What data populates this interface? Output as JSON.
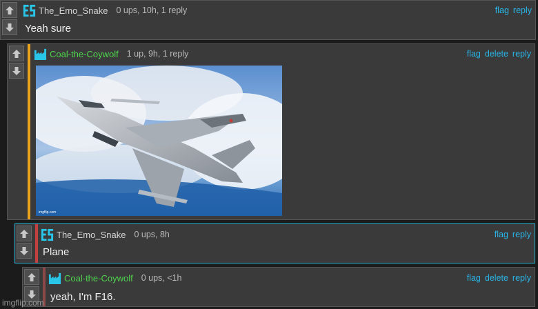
{
  "accent_colors": {
    "link": "#29b6e8",
    "green_user": "#4ed44e",
    "orange_bar": "#e8a21c",
    "red_bar": "#c34040"
  },
  "comments": [
    {
      "username": "The_Emo_Snake",
      "meta": "0 ups, 10h, 1 reply",
      "text": "Yeah sure",
      "actions": [
        "flag",
        "reply"
      ],
      "avatar": "es-avatar-icon"
    },
    {
      "username": "Coal-the-Coywolf",
      "meta": "1 up, 9h, 1 reply",
      "text": "",
      "actions": [
        "flag",
        "delete",
        "reply"
      ],
      "avatar": "factory-avatar-icon",
      "image": "f16-fighter-jet-in-clouds"
    },
    {
      "username": "The_Emo_Snake",
      "meta": "0 ups, 8h",
      "text": "Plane",
      "actions": [
        "flag",
        "reply"
      ],
      "avatar": "es-avatar-icon"
    },
    {
      "username": "Coal-the-Coywolf",
      "meta": "0 ups, <1h",
      "text": "yeah, I'm F16.",
      "actions": [
        "flag",
        "delete",
        "reply"
      ],
      "avatar": "factory-avatar-icon"
    }
  ],
  "watermark": "imgflip.com"
}
